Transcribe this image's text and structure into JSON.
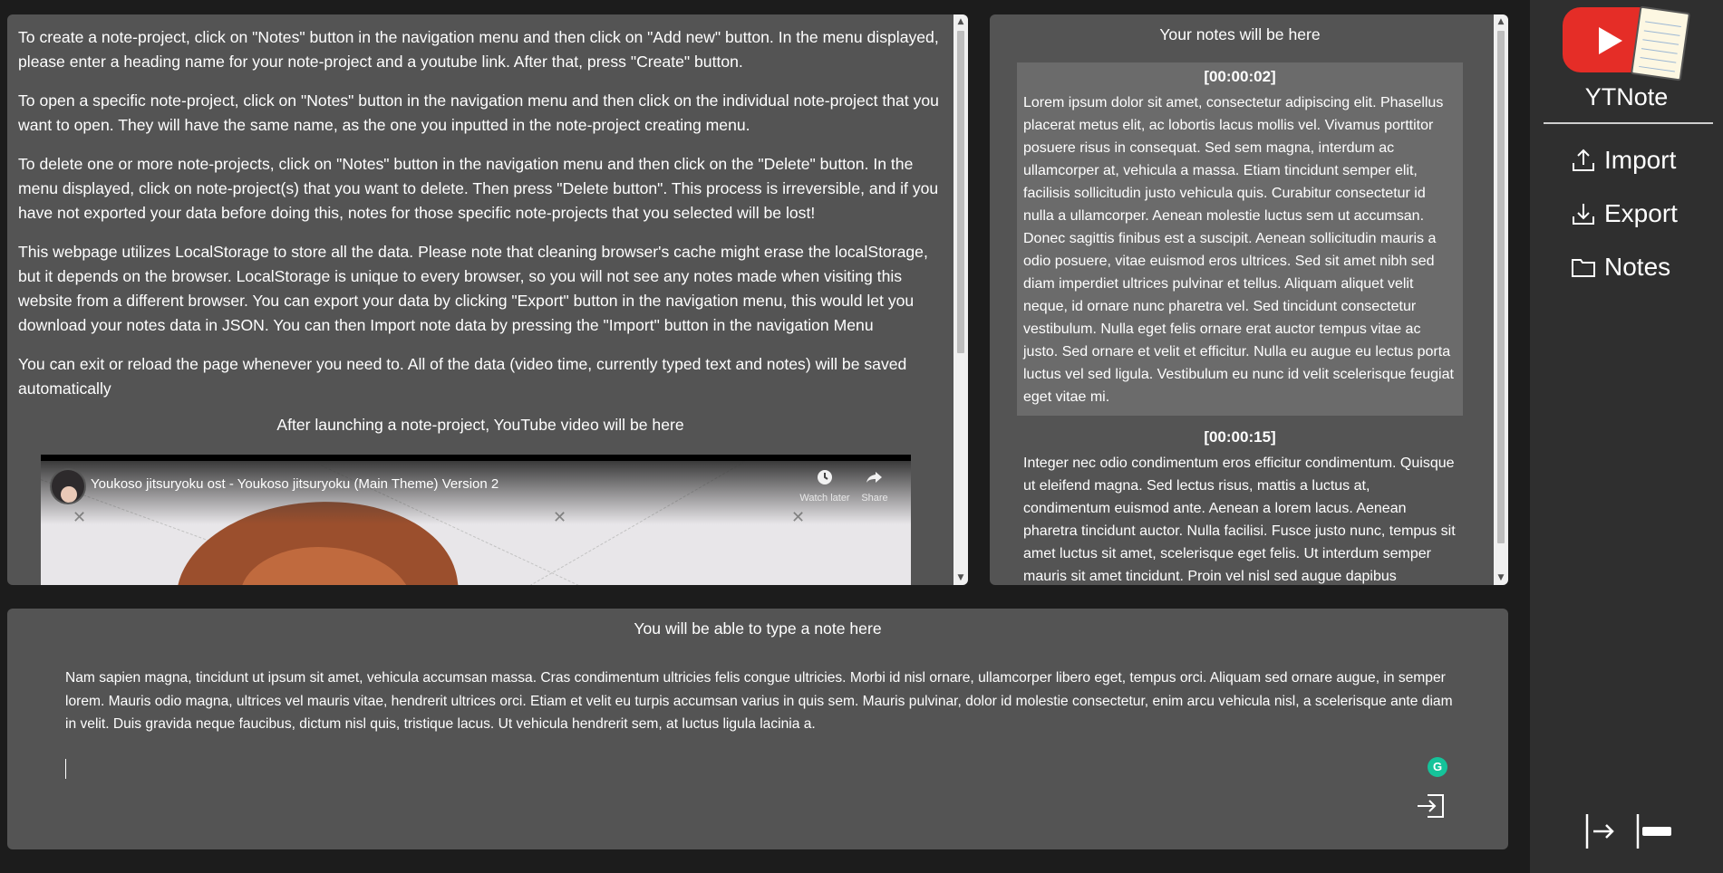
{
  "instructions": {
    "paragraphs": [
      "To create a note-project, click on \"Notes\" button in the navigation menu and then click on \"Add new\" button. In the menu displayed, please enter a heading name for your note-project and a youtube link. After that, press \"Create\" button.",
      "To open a specific note-project, click on \"Notes\" button in the navigation menu and then click on the individual note-project that you want to open. They will have the same name, as the one you inputted in the note-project creating menu.",
      "To delete one or more note-projects, click on \"Notes\" button in the navigation menu and then click on the \"Delete\" button. In the menu displayed, click on note-project(s) that you want to delete. Then press \"Delete button\". This process is irreversible, and if you have not exported your data before doing this, notes for those specific note-projects that you selected will be lost!",
      "This webpage utilizes LocalStorage to store all the data. Please note that cleaning browser's cache might erase the localStorage, but it depends on the browser. LocalStorage is unique to every browser, so you will not see any notes made when visiting this website from a different browser. You can export your data by clicking \"Export\" button in the navigation menu, this would let you download your notes data in JSON. You can then Import note data by pressing the \"Import\" button in the navigation Menu",
      "You can exit or reload the page whenever you need to. All of the data (video time, currently typed text and notes) will be saved automatically"
    ],
    "video_caption": "After launching a note-project, YouTube video will be here",
    "video": {
      "title": "Youkoso jitsuryoku ost - Youkoso jitsuryoku (Main Theme) Version 2",
      "watch_later": "Watch later",
      "share": "Share"
    }
  },
  "notes": {
    "title": "Your notes will be here",
    "items": [
      {
        "time": "[00:00:02]",
        "text": "Lorem ipsum dolor sit amet, consectetur adipiscing elit. Phasellus placerat metus elit, ac lobortis lacus mollis vel. Vivamus porttitor posuere risus in consequat. Sed sem magna, interdum ac ullamcorper at, vehicula a massa. Etiam tincidunt semper elit, facilisis sollicitudin justo vehicula quis. Curabitur consectetur id nulla a ullamcorper. Aenean molestie luctus sem ut accumsan. Donec sagittis finibus est a suscipit. Aenean sollicitudin mauris a odio posuere, vitae euismod eros ultrices. Sed sit amet nibh sed diam imperdiet ultrices pulvinar et tellus. Aliquam aliquet velit neque, id ornare nunc pharetra vel. Sed tincidunt consectetur vestibulum. Nulla eget felis ornare erat auctor tempus vitae ac justo. Sed ornare et velit et efficitur. Nulla eu augue eu lectus porta luctus vel sed ligula. Vestibulum eu nunc id velit scelerisque feugiat eget vitae mi."
      },
      {
        "time": "[00:00:15]",
        "text": "Integer nec odio condimentum eros efficitur condimentum. Quisque ut eleifend magna. Sed lectus risus, mattis a luctus at, condimentum euismod ante. Aenean a lorem lacus. Aenean pharetra tincidunt auctor. Nulla facilisi. Fusce justo nunc, tempus sit amet luctus sit amet, scelerisque eget felis. Ut interdum semper mauris sit amet tincidunt. Proin vel nisl sed augue dapibus"
      }
    ]
  },
  "editor": {
    "title": "You will be able to type a note here",
    "text": "Nam sapien magna, tincidunt ut ipsum sit amet, vehicula accumsan massa. Cras condimentum ultricies felis congue ultricies. Morbi id nisl ornare, ullamcorper libero eget, tempus orci. Aliquam sed ornare augue, in semper lorem. Mauris odio magna, ultrices vel mauris vitae, hendrerit ultrices orci. Etiam et velit eu turpis accumsan varius in quis sem. Mauris pulvinar, dolor id molestie consectetur, enim arcu vehicula nisl, a scelerisque ante diam in velit. Duis gravida neque faucibus, dictum nisl quis, tristique lacus. Ut vehicula hendrerit sem, at luctus ligula lacinia a.",
    "grammarly_letter": "G"
  },
  "sidebar": {
    "brand": "YTNote",
    "nav": [
      {
        "label": "Import",
        "icon": "upload-icon"
      },
      {
        "label": "Export",
        "icon": "download-icon"
      },
      {
        "label": "Notes",
        "icon": "folder-icon"
      }
    ],
    "footer_icons": [
      "arrow-to-right-icon",
      "collapse-bar-icon"
    ]
  },
  "colors": {
    "page_bg": "#1c1c1c",
    "panel_bg": "#545454",
    "selected_note_bg": "#6b6b6b",
    "sidebar_bg": "#2f2f2f",
    "youtube_red": "#e52d27",
    "grammarly_green": "#15c39a"
  }
}
